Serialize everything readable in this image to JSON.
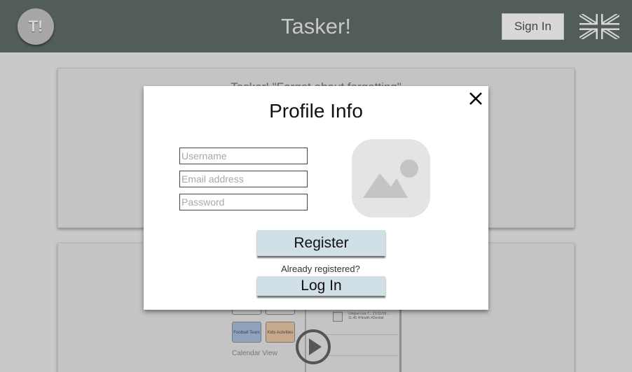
{
  "header": {
    "logo_text": "T!",
    "title": "Tasker!",
    "signin_label": "Sign In",
    "language_flag_icon": "uk-flag-icon"
  },
  "background": {
    "panel_top_heading": "Tasker! \"Forget about forgetting\"",
    "preview": {
      "tiles": [
        "",
        "",
        "Football Team",
        "Kids Activities"
      ],
      "calendar_label": "Calendar View",
      "list_item_text": "Unique Lea T... 21/11/19 ... 11:45 #Health #Dentist",
      "play_icon": "play-icon"
    }
  },
  "modal": {
    "title": "Profile Info",
    "close_icon": "close-icon",
    "username_placeholder": "Username",
    "email_placeholder": "Email address",
    "password_placeholder": "Password",
    "avatar_icon": "image-placeholder-icon",
    "register_label": "Register",
    "already_registered_text": "Already registered?",
    "login_label": "Log In"
  },
  "colors": {
    "header_bg": "#515c5b",
    "overlay_bg": "#c9c9c9",
    "button_bg": "#d1dfe6",
    "modal_bg": "#ffffff"
  }
}
